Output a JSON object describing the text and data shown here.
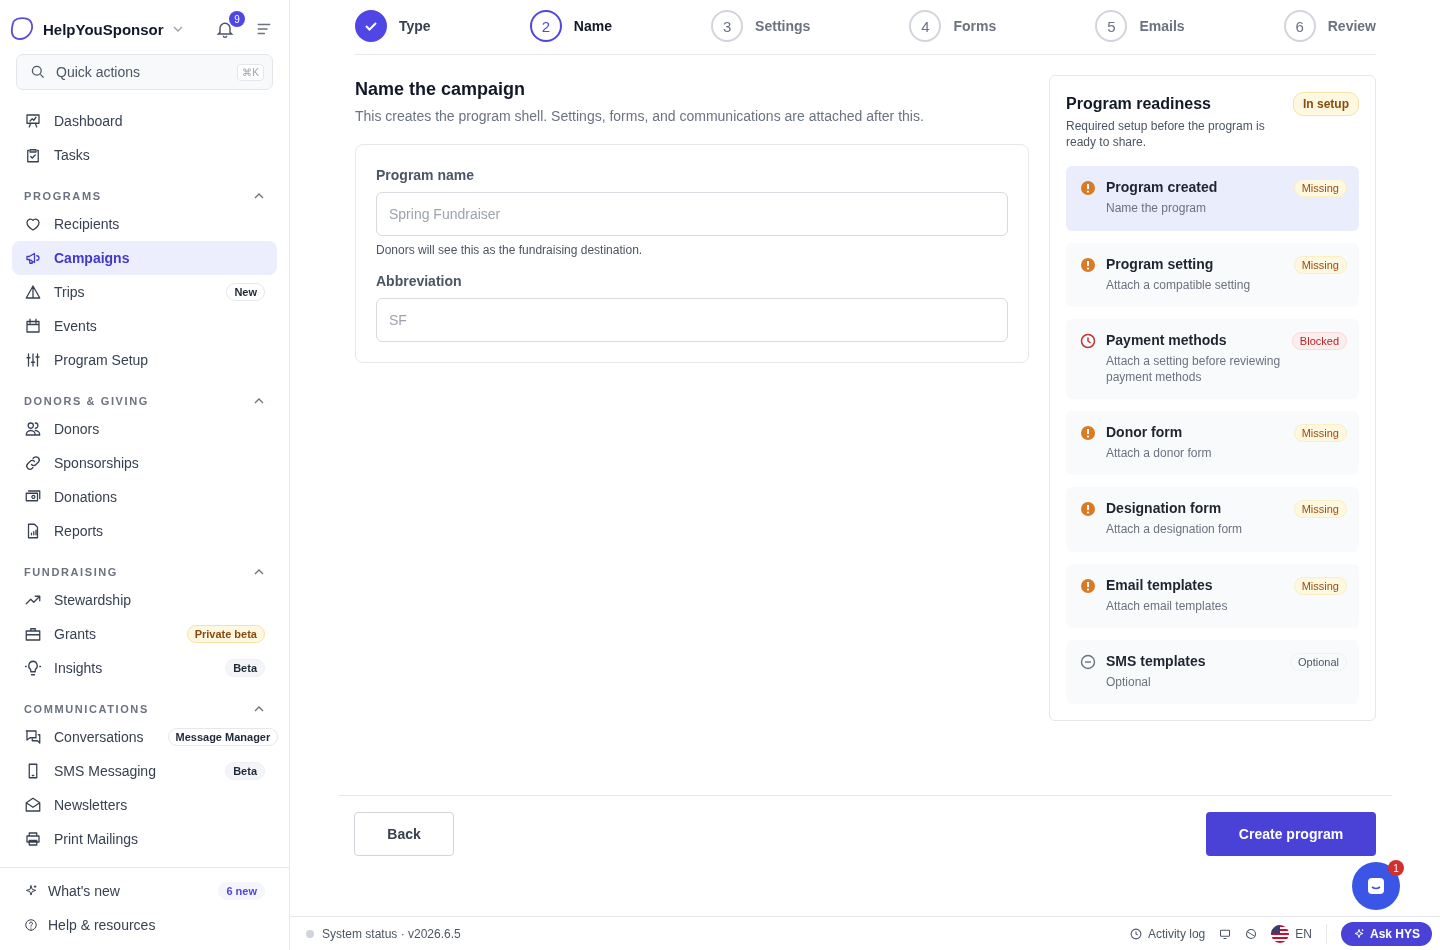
{
  "sidebar": {
    "brand": {
      "name": "HelpYouSponsor",
      "notifications": "9"
    },
    "search": {
      "placeholder": "Quick actions",
      "shortcut": "⌘K"
    },
    "top_items": [
      {
        "label": "Dashboard",
        "selected": false
      },
      {
        "label": "Tasks",
        "selected": false
      }
    ],
    "sections": [
      {
        "title": "PROGRAMS",
        "expanded": true,
        "items": [
          {
            "label": "Recipients",
            "selected": false
          },
          {
            "label": "Campaigns",
            "selected": true
          },
          {
            "label": "Trips",
            "selected": false,
            "badge": "New",
            "kind": "neutral"
          },
          {
            "label": "Events",
            "selected": false
          },
          {
            "label": "Program Setup",
            "selected": false
          }
        ]
      },
      {
        "title": "DONORS & GIVING",
        "expanded": true,
        "items": [
          {
            "label": "Donors",
            "selected": false
          },
          {
            "label": "Sponsorships",
            "selected": false
          },
          {
            "label": "Donations",
            "selected": false
          },
          {
            "label": "Reports",
            "selected": false
          }
        ]
      },
      {
        "title": "FUNDRAISING",
        "expanded": true,
        "items": [
          {
            "label": "Stewardship",
            "selected": false
          },
          {
            "label": "Grants",
            "selected": false,
            "badge": "Private beta",
            "kind": "warning"
          },
          {
            "label": "Insights",
            "selected": false,
            "badge": "Beta",
            "kind": "muted"
          }
        ]
      },
      {
        "title": "COMMUNICATIONS",
        "expanded": true,
        "items": [
          {
            "label": "Conversations",
            "selected": false,
            "badge": "Message Manager",
            "kind": "neutral"
          },
          {
            "label": "SMS Messaging",
            "selected": false,
            "badge": "Beta",
            "kind": "muted"
          },
          {
            "label": "Newsletters",
            "selected": false
          },
          {
            "label": "Print Mailings",
            "selected": false
          }
        ]
      }
    ],
    "footer_items": [
      {
        "label": "What's new",
        "badge": "6 new",
        "kind": "accent"
      },
      {
        "label": "Help & resources"
      }
    ]
  },
  "stepper": [
    {
      "label": "Type",
      "completed": true,
      "selected": false
    },
    {
      "number": "2",
      "label": "Name",
      "completed": false,
      "selected": true
    },
    {
      "number": "3",
      "label": "Settings",
      "completed": false,
      "selected": false
    },
    {
      "number": "4",
      "label": "Forms",
      "completed": false,
      "selected": false
    },
    {
      "number": "5",
      "label": "Emails",
      "completed": false,
      "selected": false
    },
    {
      "number": "6",
      "label": "Review",
      "completed": false,
      "selected": false
    }
  ],
  "form": {
    "title": "Name the campaign",
    "subtitle": "This creates the program shell. Settings, forms, and communications are attached after this.",
    "fields": [
      {
        "label": "Program name",
        "placeholder": "Spring Fundraiser",
        "help": "Donors will see this as the fundraising destination."
      },
      {
        "label": "Abbreviation",
        "placeholder": "SF"
      }
    ]
  },
  "readiness": {
    "title": "Program readiness",
    "badge": "In setup",
    "description": "Required setup before the program is ready to share.",
    "items": [
      {
        "title": "Program created",
        "detail": "Name the program",
        "kind": "missing",
        "status_label": "Missing",
        "selected": true
      },
      {
        "title": "Program setting",
        "detail": "Attach a compatible setting",
        "kind": "missing",
        "status_label": "Missing",
        "selected": false
      },
      {
        "title": "Payment methods",
        "detail": "Attach a setting before reviewing payment methods",
        "kind": "blocked",
        "status_label": "Blocked",
        "selected": false
      },
      {
        "title": "Donor form",
        "detail": "Attach a donor form",
        "kind": "missing",
        "status_label": "Missing",
        "selected": false
      },
      {
        "title": "Designation form",
        "detail": "Attach a designation form",
        "kind": "missing",
        "status_label": "Missing",
        "selected": false
      },
      {
        "title": "Email templates",
        "detail": "Attach email templates",
        "kind": "missing",
        "status_label": "Missing",
        "selected": false
      },
      {
        "title": "SMS templates",
        "detail": "Optional",
        "kind": "optional",
        "status_label": "Optional",
        "selected": false
      }
    ]
  },
  "actions": {
    "back": "Back",
    "primary": "Create program"
  },
  "chat_launcher": {
    "count": "1"
  },
  "status_bar": {
    "status": "System status · v2026.6.5",
    "activity": "Activity log",
    "language": "EN",
    "assistant": "Ask HYS"
  }
}
